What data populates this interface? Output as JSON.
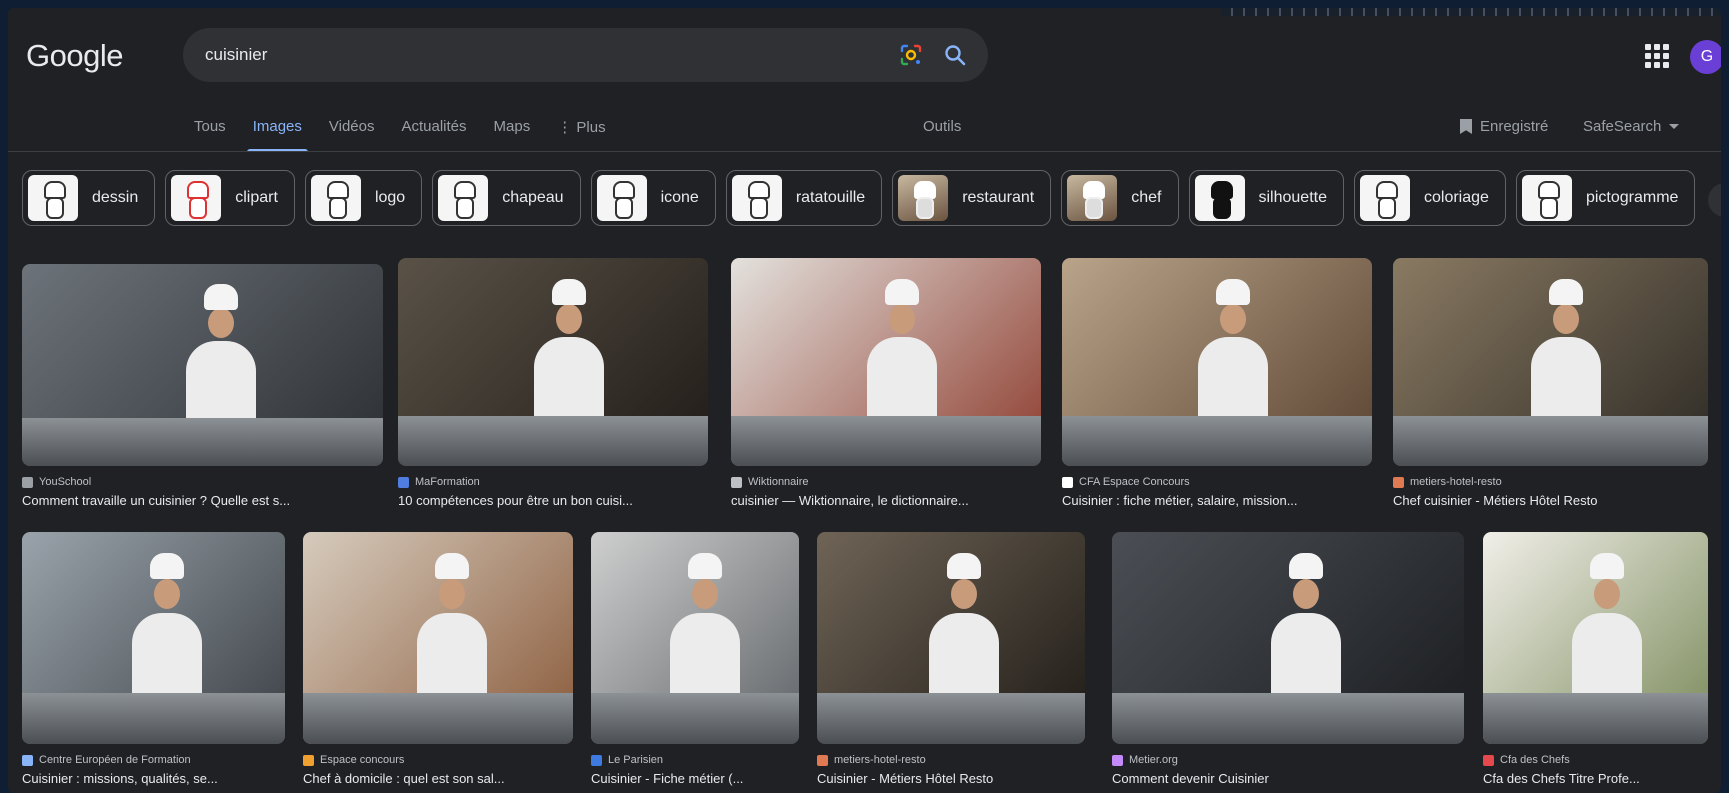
{
  "header": {
    "logo": "Google",
    "search_value": "cuisinier",
    "avatar_letter": "G"
  },
  "tabs": [
    {
      "label": "Tous",
      "active": false
    },
    {
      "label": "Images",
      "active": true
    },
    {
      "label": "Vidéos",
      "active": false
    },
    {
      "label": "Actualités",
      "active": false
    },
    {
      "label": "Maps",
      "active": false
    },
    {
      "label": "⋮ Plus",
      "active": false
    }
  ],
  "tools_label": "Outils",
  "saved_label": "Enregistré",
  "safesearch_label": "SafeSearch",
  "chips": [
    {
      "label": "dessin",
      "style": "plain"
    },
    {
      "label": "clipart",
      "style": "red"
    },
    {
      "label": "logo",
      "style": "plain"
    },
    {
      "label": "chapeau",
      "style": "plain"
    },
    {
      "label": "icone",
      "style": "plain"
    },
    {
      "label": "ratatouille",
      "style": "plain"
    },
    {
      "label": "restaurant",
      "style": "photo"
    },
    {
      "label": "chef",
      "style": "photo"
    },
    {
      "label": "silhouette",
      "style": "sil"
    },
    {
      "label": "coloriage",
      "style": "plain"
    },
    {
      "label": "pictogramme",
      "style": "plain"
    }
  ],
  "results": [
    {
      "source": "YouSchool",
      "caption": "Comment travaille un cuisinier ? Quelle est s...",
      "favicon_color": "#9aa0a6",
      "bg": "linear-gradient(135deg,#6d737a,#2b2f33)"
    },
    {
      "source": "MaFormation",
      "caption": "10 compétences pour être un bon cuisi...",
      "favicon_color": "#4f7de0",
      "bg": "linear-gradient(135deg,#5a5247,#1f1b17)"
    },
    {
      "source": "Wiktionnaire",
      "caption": "cuisinier — Wiktionnaire, le dictionnaire...",
      "favicon_color": "#bdc1c6",
      "bg": "linear-gradient(135deg,#e3e1dd,#8e3d2f)"
    },
    {
      "source": "CFA Espace Concours",
      "caption": "Cuisinier : fiche métier, salaire, mission...",
      "favicon_color": "#ffffff",
      "bg": "linear-gradient(135deg,#b9a48a,#5a4331)"
    },
    {
      "source": "metiers-hotel-resto",
      "caption": "Chef cuisinier - Métiers Hôtel Resto",
      "favicon_color": "#e07a52",
      "bg": "linear-gradient(135deg,#8a7a62,#2d2a25)"
    },
    {
      "source": "Centre Européen de Formation",
      "caption": "Cuisinier : missions, qualités, se...",
      "favicon_color": "#8ab4f8",
      "bg": "linear-gradient(135deg,#9aa3ab,#3b4045)"
    },
    {
      "source": "Espace concours",
      "caption": "Chef à domicile : quel est son sal...",
      "favicon_color": "#f0a030",
      "bg": "linear-gradient(135deg,#d6cbbd,#8a5a3a)"
    },
    {
      "source": "Le Parisien",
      "caption": "Cuisinier - Fiche métier (...",
      "favicon_color": "#3d7be0",
      "bg": "linear-gradient(135deg,#cfcfcf,#5e6266)"
    },
    {
      "source": "metiers-hotel-resto",
      "caption": "Cuisinier - Métiers Hôtel Resto",
      "favicon_color": "#e07a52",
      "bg": "linear-gradient(135deg,#6f6456,#1e1a16)"
    },
    {
      "source": "Metier.org",
      "caption": "Comment devenir Cuisinier",
      "favicon_color": "#c58af9",
      "bg": "linear-gradient(135deg,#4b4f55,#1a1c1f)"
    },
    {
      "source": "Cfa des Chefs",
      "caption": "Cfa des Chefs Titre Profe...",
      "favicon_color": "#e5484d",
      "bg": "linear-gradient(135deg,#f1efe9,#7a8a5a)"
    }
  ]
}
